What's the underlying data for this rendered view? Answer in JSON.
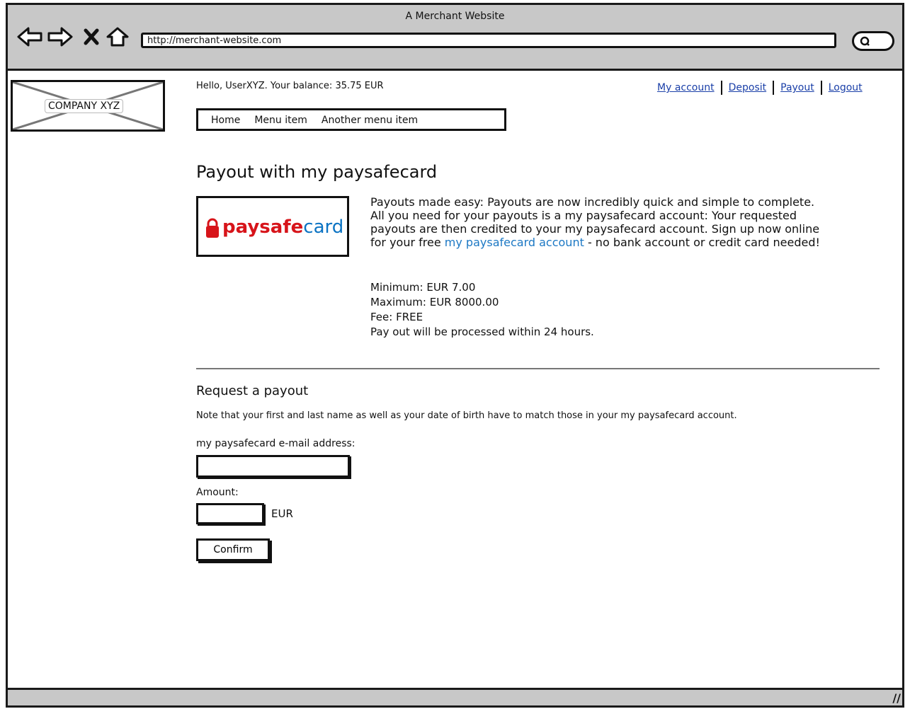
{
  "browser": {
    "title": "A Merchant Website",
    "url": "http://merchant-website.com"
  },
  "site": {
    "logo_text": "COMPANY XYZ",
    "greeting": "Hello, UserXYZ. Your balance: 35.75 EUR",
    "links": [
      "My account",
      "Deposit",
      "Payout",
      "Logout"
    ],
    "menu": [
      "Home",
      "Menu item",
      "Another menu item"
    ]
  },
  "page": {
    "title": "Payout with my paysafecard",
    "brand_logo": {
      "bold": "paysafe",
      "light": "card"
    },
    "intro_before_link": "Payouts made easy: Payouts are now incredibly quick and simple to complete. All you need for your payouts is a my paysafecard account: Your requested payouts are then credited to your my paysafecard account. Sign up now online for your free ",
    "intro_link": "my paysafecard account",
    "intro_after_link": " - no bank account or credit card needed!",
    "limits": [
      "Minimum:  EUR 7.00",
      "Maximum:  EUR 8000.00",
      "Fee:  FREE",
      "Pay out will be processed within 24 hours."
    ]
  },
  "form": {
    "title": "Request a payout",
    "note": "Note that your first and last name as well as your date of birth have to match those in your my paysafecard account.",
    "email_label": "my paysafecard e-mail address:",
    "email_value": "",
    "amount_label": "Amount:",
    "amount_value": "",
    "currency": "EUR",
    "confirm_label": "Confirm"
  },
  "colors": {
    "chrome": "#c8c8c8",
    "link": "#1a3fa8",
    "brand_red": "#d7141a",
    "brand_blue": "#0b73c3"
  }
}
